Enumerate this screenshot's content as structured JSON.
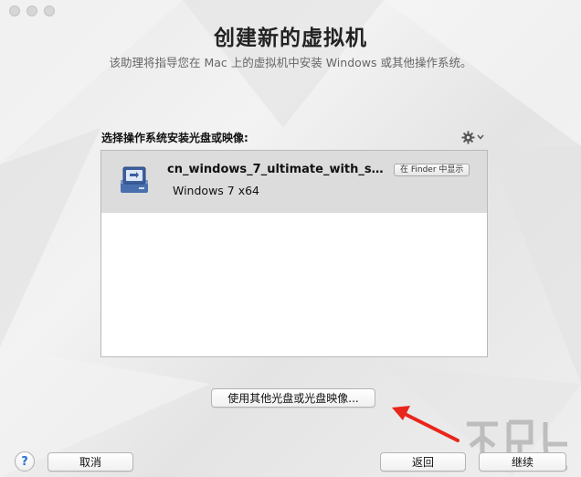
{
  "window": {
    "title": "创建新的虚拟机",
    "subtitle": "该助理将指导您在 Mac 上的虚拟机中安装 Windows 或其他操作系统。"
  },
  "source": {
    "label": "选择操作系统安装光盘或映像:",
    "items": [
      {
        "name": "cn_windows_7_ultimate_with_sp1_x...",
        "os": "Windows 7 x64",
        "finder_button": "在 Finder 中显示",
        "selected": true
      }
    ]
  },
  "buttons": {
    "other_disc": "使用其他光盘或光盘映像...",
    "help": "?",
    "cancel": "取消",
    "back": "返回",
    "continue": "继续"
  },
  "colors": {
    "selection": "#dcdcdc",
    "arrow": "#e8261c",
    "help_glyph": "#2b6fd6"
  },
  "icons": {
    "gear": "gear-icon",
    "disk": "disk-image-icon",
    "arrow": "red-arrow-annotation"
  }
}
